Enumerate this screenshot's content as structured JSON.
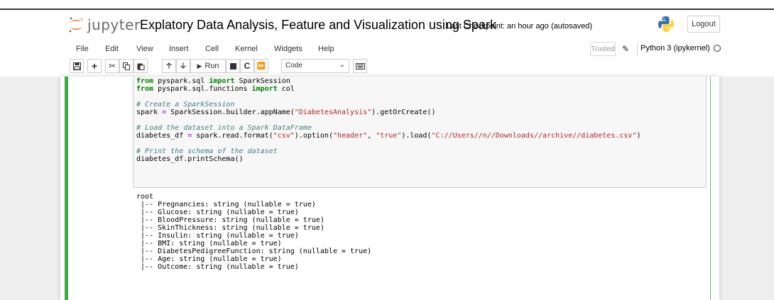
{
  "header": {
    "logo_text": "jupyter",
    "notebook_title": "Explatory Data Analysis, Feature and Visualization using Spark",
    "checkpoint": "Last Checkpoint: an hour ago",
    "autosave": "(autosaved)",
    "logout_label": "Logout"
  },
  "menubar": {
    "items": [
      "File",
      "Edit",
      "View",
      "Insert",
      "Cell",
      "Kernel",
      "Widgets",
      "Help"
    ],
    "trusted_label": "Trusted",
    "kernel_name": "Python 3 (ipykernel)"
  },
  "toolbar": {
    "run_label": "Run",
    "cell_type": "Code",
    "icons": [
      "save-icon",
      "add-cell-icon",
      "cut-icon",
      "copy-icon",
      "paste-icon",
      "move-up-icon",
      "move-down-icon",
      "run-icon",
      "interrupt-icon",
      "restart-icon",
      "fast-forward-icon",
      "keyboard-icon"
    ]
  },
  "cell": {
    "code_lines": [
      "from pyspark.sql import SparkSession",
      "from pyspark.sql.functions import col",
      "",
      "# Create a SparkSession",
      "spark = SparkSession.builder.appName(\"DiabetesAnalysis\").getOrCreate()",
      "",
      "# Load the dataset into a Spark DataFrame",
      "diabetes_df = spark.read.format(\"csv\").option(\"header\", \"true\").load(\"C://Users//n//Downloads//archive//diabetes.csv\")",
      "",
      "# Print the schema of the dataset",
      "diabetes_df.printSchema()"
    ],
    "output_lines": [
      "root",
      " |-- Pregnancies: string (nullable = true)",
      " |-- Glucose: string (nullable = true)",
      " |-- BloodPressure: string (nullable = true)",
      " |-- SkinThickness: string (nullable = true)",
      " |-- Insulin: string (nullable = true)",
      " |-- BMI: string (nullable = true)",
      " |-- DiabetesPedigreeFunction: string (nullable = true)",
      " |-- Age: string (nullable = true)",
      " |-- Outcome: string (nullable = true)"
    ]
  },
  "colors": {
    "cell_selected_border": "#42a942",
    "keyword": "#008000",
    "comment": "#408080",
    "string": "#ba2121"
  }
}
